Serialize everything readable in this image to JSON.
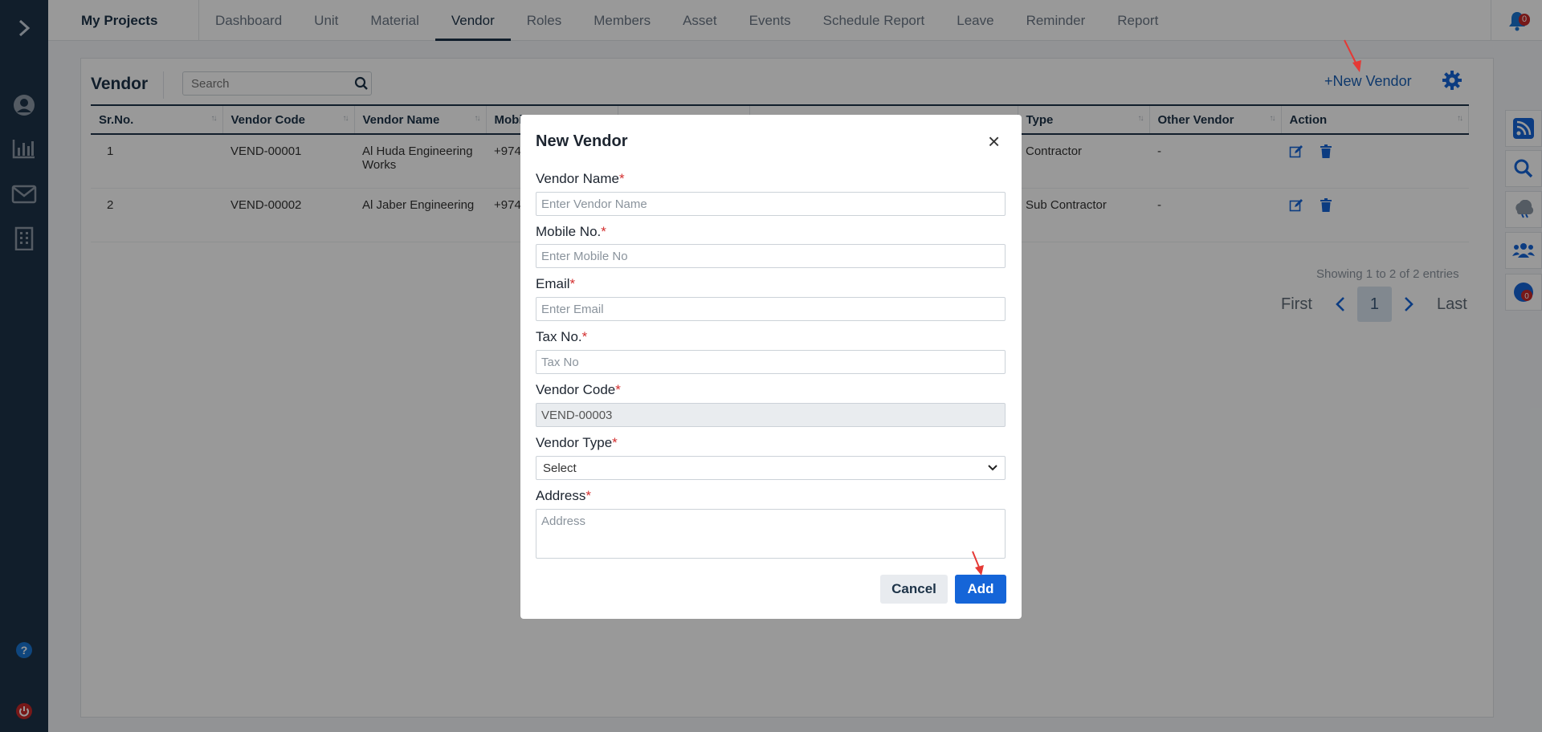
{
  "sidebar": {
    "icons": [
      "chevron-right-icon",
      "user-icon",
      "bar-chart-icon",
      "mail-icon",
      "building-icon",
      "help-icon",
      "power-icon"
    ]
  },
  "topbar": {
    "brand": "My Projects",
    "nav": [
      "Dashboard",
      "Unit",
      "Material",
      "Vendor",
      "Roles",
      "Members",
      "Asset",
      "Events",
      "Schedule Report",
      "Leave",
      "Reminder",
      "Report"
    ],
    "active_tab": "Vendor",
    "notification_count": "0"
  },
  "page": {
    "title": "Vendor",
    "search_placeholder": "Search",
    "new_vendor_label": "+New Vendor"
  },
  "table": {
    "columns": [
      "Sr.No.",
      "Vendor Code",
      "Vendor Name",
      "Mobi",
      "",
      "",
      "Type",
      "Other Vendor",
      "Action"
    ],
    "rows": [
      {
        "sr": "1",
        "code": "VEND-00001",
        "name": "Al Huda Engineering Works",
        "mobile": "+974",
        "type": "Contractor",
        "other": "-"
      },
      {
        "sr": "2",
        "code": "VEND-00002",
        "name": "Al Jaber Engineering",
        "mobile": "+974",
        "type": "Sub Contractor",
        "other": "-"
      }
    ],
    "showing": "Showing 1 to 2 of 2 entries",
    "pager": {
      "first": "First",
      "page": "1",
      "last": "Last"
    }
  },
  "right_dock": {
    "icons": [
      "rss-icon",
      "search-icon",
      "weather-icon",
      "team-icon",
      "badge-icon"
    ],
    "badge_count": "0"
  },
  "modal": {
    "title": "New Vendor",
    "close": "×",
    "fields": {
      "vendor_name": {
        "label": "Vendor Name",
        "placeholder": "Enter Vendor Name"
      },
      "mobile": {
        "label": "Mobile No.",
        "placeholder": "Enter Mobile No"
      },
      "email": {
        "label": "Email",
        "placeholder": "Enter Email"
      },
      "tax": {
        "label": "Tax No.",
        "placeholder": "Tax No"
      },
      "vendor_code": {
        "label": "Vendor Code",
        "value": "VEND-00003"
      },
      "vendor_type": {
        "label": "Vendor Type",
        "selected": "Select"
      },
      "address": {
        "label": "Address",
        "placeholder": "Address"
      }
    },
    "required_mark": "*",
    "cancel_label": "Cancel",
    "add_label": "Add"
  },
  "colors": {
    "sidebar": "#1d3348",
    "accent": "#1565d8",
    "required": "#d32f2f",
    "annotation_arrow": "#e53935"
  }
}
